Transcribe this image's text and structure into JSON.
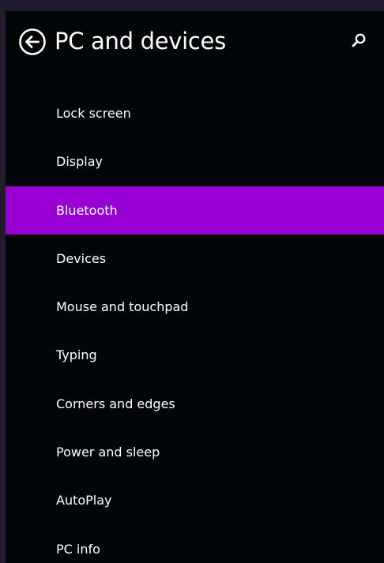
{
  "header": {
    "title": "PC and devices",
    "back_icon": "back-arrow-circle-icon",
    "search_icon": "search-icon"
  },
  "nav": {
    "selected_index": 2,
    "accent_color": "#9600d2",
    "items": [
      {
        "label": "Lock screen"
      },
      {
        "label": "Display"
      },
      {
        "label": "Bluetooth"
      },
      {
        "label": "Devices"
      },
      {
        "label": "Mouse and touchpad"
      },
      {
        "label": "Typing"
      },
      {
        "label": "Corners and edges"
      },
      {
        "label": "Power and sleep"
      },
      {
        "label": "AutoPlay"
      },
      {
        "label": "PC info"
      }
    ]
  },
  "colors": {
    "background": "#020608",
    "frame": "#211b2d",
    "text": "#ffffff"
  }
}
